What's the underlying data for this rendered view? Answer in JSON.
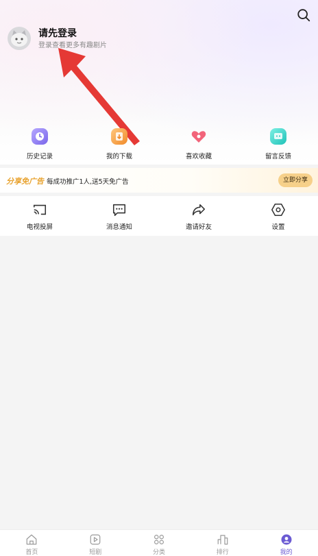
{
  "header": {
    "login_title": "请先登录",
    "login_subtitle": "登录查看更多有趣剧片"
  },
  "icons": {
    "search": "search-icon",
    "avatar": "avatar"
  },
  "quick_actions": [
    {
      "label": "历史记录",
      "icon": "history-icon",
      "color": "#8f7cf0"
    },
    {
      "label": "我的下载",
      "icon": "download-icon",
      "color": "#f5a24a"
    },
    {
      "label": "喜欢收藏",
      "icon": "heart-icon",
      "color": "#f2647a"
    },
    {
      "label": "留言反馈",
      "icon": "feedback-icon",
      "color": "#2fd1c5"
    }
  ],
  "promo": {
    "title": "分享免广告",
    "text": "每成功推广1人,送5天免广告",
    "button": "立即分享"
  },
  "tools": [
    {
      "label": "电视投屏",
      "icon": "cast-icon"
    },
    {
      "label": "消息通知",
      "icon": "message-icon"
    },
    {
      "label": "邀请好友",
      "icon": "share-icon"
    },
    {
      "label": "设置",
      "icon": "settings-icon"
    }
  ],
  "tabs": [
    {
      "label": "首页",
      "icon": "home-icon"
    },
    {
      "label": "短剧",
      "icon": "play-icon"
    },
    {
      "label": "分类",
      "icon": "category-icon"
    },
    {
      "label": "排行",
      "icon": "ranking-icon"
    },
    {
      "label": "我的",
      "icon": "profile-icon",
      "active": true
    }
  ],
  "colors": {
    "accent": "#6b5bd3",
    "promo_gold": "#e8a330",
    "annotation_arrow": "#e53935"
  }
}
